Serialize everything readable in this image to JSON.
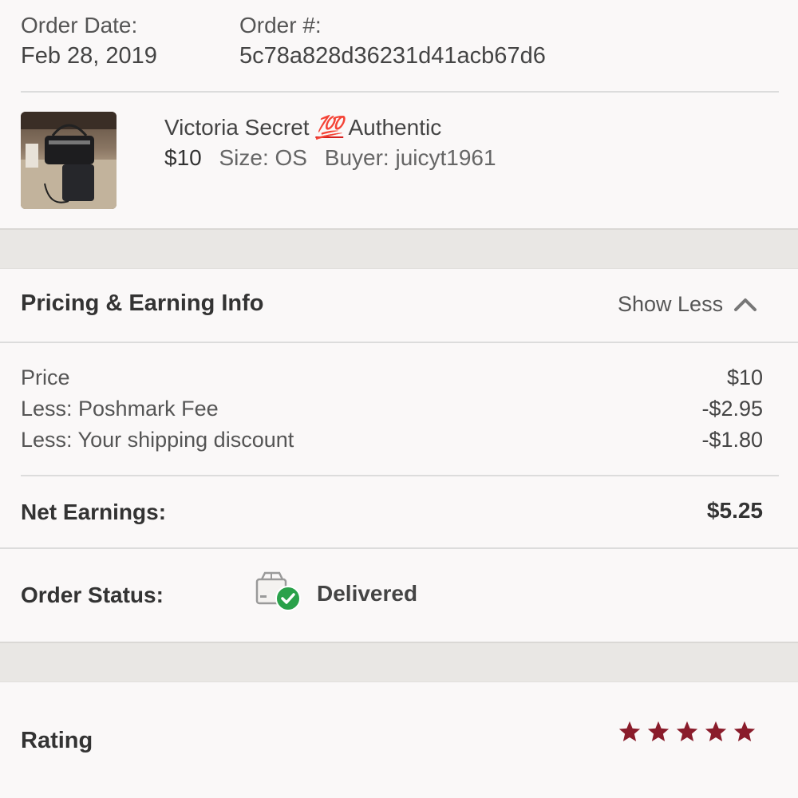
{
  "order": {
    "date_label": "Order Date:",
    "date_value": "Feb 28, 2019",
    "number_label": "Order #:",
    "number_value": "5c78a828d36231d41acb67d6"
  },
  "item": {
    "title_prefix": "Victoria Secret",
    "title_emoji": "💯",
    "title_suffix": "Authentic",
    "price": "$10",
    "size": "Size: OS",
    "buyer": "Buyer: juicyt1961"
  },
  "pricing": {
    "header": "Pricing & Earning Info",
    "toggle_label": "Show Less",
    "rows": [
      {
        "label": "Price",
        "value": "$10"
      },
      {
        "label": "Less: Poshmark Fee",
        "value": "-$2.95"
      },
      {
        "label": "Less: Your shipping discount",
        "value": "-$1.80"
      }
    ],
    "net_label": "Net Earnings:",
    "net_value": "$5.25"
  },
  "status": {
    "label": "Order Status:",
    "value": "Delivered"
  },
  "rating": {
    "label": "Rating",
    "stars": 5,
    "star_color": "#8a1c2b"
  }
}
